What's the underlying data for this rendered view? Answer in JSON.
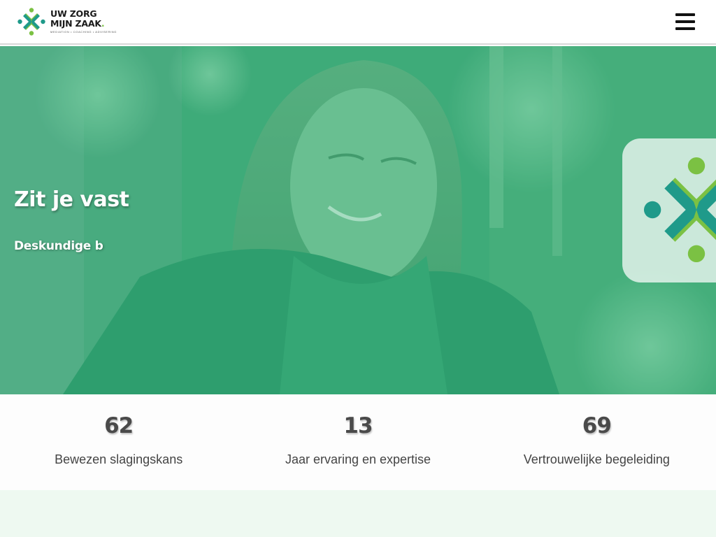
{
  "header": {
    "logo": {
      "line1": "UW ZORG",
      "line2": "MIJN ZAAK",
      "dot": ".",
      "tagline": "MEDIATION • COACHING • ADVISERING",
      "icon": "logo-cross-icon"
    },
    "menu_icon": "hamburger-menu-icon"
  },
  "hero": {
    "title": "Zit je vast",
    "subtitle": "Deskundige b",
    "overlay_color": "#2eaf78"
  },
  "stats": [
    {
      "number": "62",
      "label": "Bewezen slagingskans"
    },
    {
      "number": "13",
      "label": "Jaar ervaring en expertise"
    },
    {
      "number": "69",
      "label": "Vertrouwelijke begeleiding"
    }
  ],
  "colors": {
    "brand_teal": "#1f9a8a",
    "brand_green": "#7bc143",
    "bottom_band": "#eef9f1"
  }
}
